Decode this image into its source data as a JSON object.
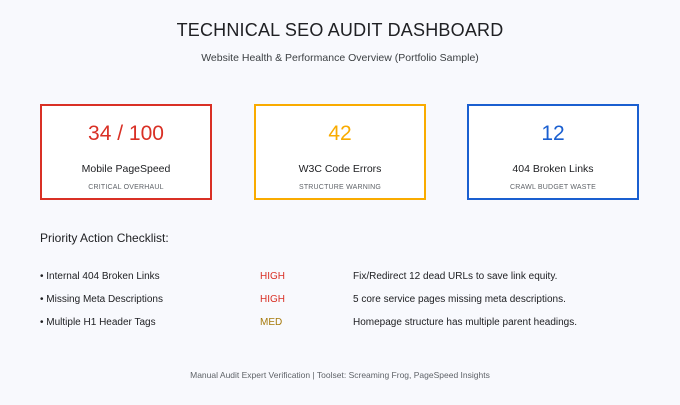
{
  "header": {
    "title": "TECHNICAL SEO AUDIT DASHBOARD",
    "subtitle": "Website Health & Performance Overview (Portfolio Sample)"
  },
  "cards": [
    {
      "value": "34 / 100",
      "label": "Mobile PageSpeed",
      "sub": "CRITICAL OVERHAUL",
      "color": "#d93025"
    },
    {
      "value": "42",
      "label": "W3C Code Errors",
      "sub": "STRUCTURE WARNING",
      "color": "#f9ab00"
    },
    {
      "value": "12",
      "label": "404 Broken Links",
      "sub": "CRAWL BUDGET WASTE",
      "color": "#1a5fd0"
    }
  ],
  "checklist": {
    "title": "Priority Action Checklist:",
    "rows": [
      {
        "item": "• Internal 404 Broken Links",
        "priority": "HIGH",
        "priority_color": "#d93025",
        "note": "Fix/Redirect 12 dead URLs to save link equity."
      },
      {
        "item": "• Missing Meta Descriptions",
        "priority": "HIGH",
        "priority_color": "#d93025",
        "note": "5 core service pages missing meta descriptions."
      },
      {
        "item": "• Multiple H1 Header Tags",
        "priority": "MED",
        "priority_color": "#a5790b",
        "note": "Homepage structure has multiple parent headings."
      }
    ]
  },
  "footer": {
    "text": "Manual Audit Expert Verification | Toolset: Screaming Frog, PageSpeed Insights"
  }
}
